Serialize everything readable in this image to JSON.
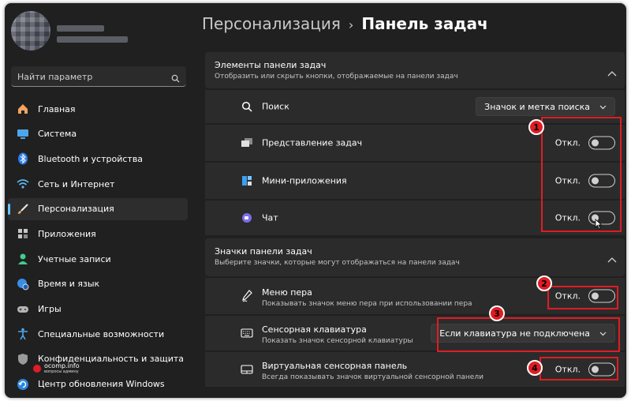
{
  "sidebar": {
    "search_placeholder": "Найти параметр",
    "items": [
      {
        "label": "Главная",
        "icon": "home-icon"
      },
      {
        "label": "Система",
        "icon": "system-icon"
      },
      {
        "label": "Bluetooth и устройства",
        "icon": "bluetooth-icon"
      },
      {
        "label": "Сеть и Интернет",
        "icon": "wifi-icon"
      },
      {
        "label": "Персонализация",
        "icon": "brush-icon",
        "active": true
      },
      {
        "label": "Приложения",
        "icon": "apps-icon"
      },
      {
        "label": "Учетные записи",
        "icon": "account-icon"
      },
      {
        "label": "Время и язык",
        "icon": "globe-clock-icon"
      },
      {
        "label": "Игры",
        "icon": "gamepad-icon"
      },
      {
        "label": "Специальные возможности",
        "icon": "accessibility-icon"
      },
      {
        "label": "Конфиденциальность и защита",
        "icon": "shield-icon"
      },
      {
        "label": "Центр обновления Windows",
        "icon": "update-icon"
      }
    ]
  },
  "breadcrumb": {
    "parent": "Персонализация",
    "separator": "›",
    "current": "Панель задач"
  },
  "section1": {
    "title": "Элементы панели задач",
    "subtitle": "Отобразить или скрыть кнопки, отображаемые на панели задач",
    "rows": [
      {
        "label": "Поиск",
        "icon": "search-icon",
        "dropdown": "Значок и метка поиска"
      },
      {
        "label": "Представление задач",
        "icon": "task-view-icon",
        "state": "Откл."
      },
      {
        "label": "Мини-приложения",
        "icon": "widgets-icon",
        "state": "Откл."
      },
      {
        "label": "Чат",
        "icon": "chat-icon",
        "state": "Откл."
      }
    ]
  },
  "section2": {
    "title": "Значки панели задач",
    "subtitle": "Выберите значки, которые могут отображаться на панели задач",
    "rows": [
      {
        "title": "Меню пера",
        "subtitle": "Показывать значок меню пера при использовании пера",
        "icon": "pen-icon",
        "state": "Откл."
      },
      {
        "title": "Сенсорная клавиатура",
        "subtitle": "Показать значок сенсорной клавиатуры",
        "icon": "keyboard-icon",
        "dropdown": "Если клавиатура не подключена"
      },
      {
        "title": "Виртуальная сенсорная панель",
        "subtitle": "Всегда показывать значок виртуальной сенсорной панели",
        "icon": "touchpad-icon",
        "state": "Откл."
      }
    ]
  },
  "annotations": [
    "1",
    "2",
    "3",
    "4"
  ],
  "watermark": {
    "title": "ocomp.info",
    "subtitle": "вопросы админу"
  },
  "colors": {
    "window_bg": "#202020",
    "card_bg": "#2b2b2b",
    "accent": "#6cc4ff",
    "annotation_red": "#e01c24"
  }
}
